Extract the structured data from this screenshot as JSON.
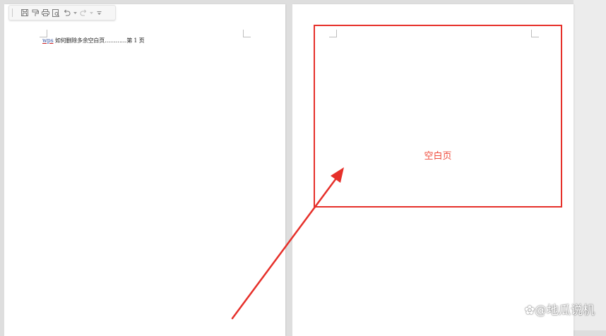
{
  "document": {
    "toc_entry": {
      "link_text": "wps",
      "title": " 如何删除多余空白页",
      "leader": "…………",
      "page_ref": "第 1 页"
    },
    "blank_page_label": "空白页"
  },
  "toolbar": {
    "buttons": [
      "save-icon",
      "format-painter-icon",
      "print-icon",
      "print-preview-icon",
      "undo-icon",
      "redo-icon",
      "customize-icon"
    ]
  },
  "annotation": {
    "color": "#e6302a",
    "label_color": "#ef4a3a"
  },
  "watermark": {
    "text": "@地瓜说机"
  }
}
